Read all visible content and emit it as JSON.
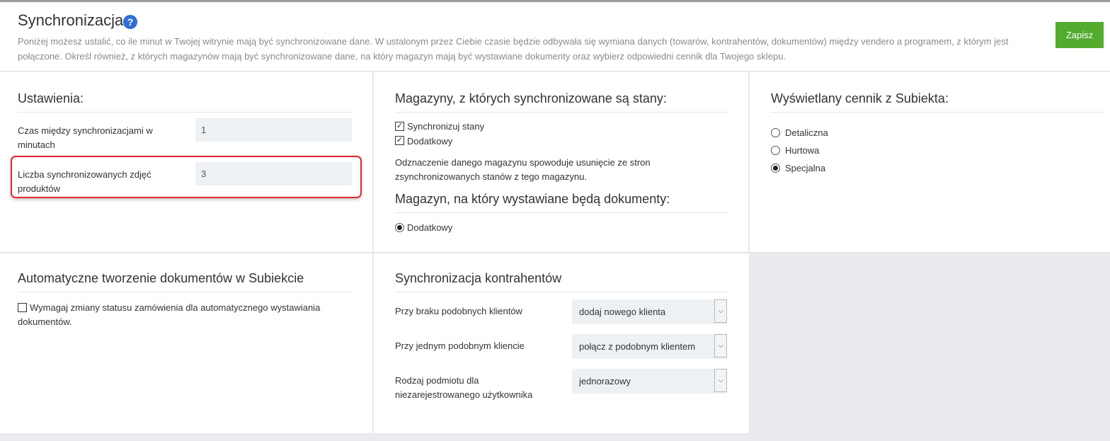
{
  "header": {
    "title": "Synchronizacja",
    "help_icon": "?",
    "description": "Poniżej możesz ustalić, co ile minut w Twojej witrynie mają być synchronizowane dane. W ustalonym przez Ciebie czasie będzie odbywała się wymiana danych (towarów, kontrahentów, dokumentów) między vendero a programem, z którym jest połączone. Określ również, z których magazynów mają być synchronizowane dane, na który magazyn mają być wystawiane dokumenty oraz wybierz odpowiedni cennik dla Twojego sklepu.",
    "save_label": "Zapisz"
  },
  "settings": {
    "title": "Ustawienia:",
    "sync_interval_label": "Czas między synchronizacjami w minutach",
    "sync_interval_value": "1",
    "photo_count_label": "Liczba synchronizowanych zdjęć produktów",
    "photo_count_value": "3"
  },
  "warehouses": {
    "title": "Magazyny, z których synchronizowane są stany:",
    "sync_stock_label": "Synchronizuj stany",
    "sync_stock_checked": true,
    "additional_label": "Dodatkowy",
    "additional_checked": true,
    "note": "Odznaczenie danego magazynu spowoduje usunięcie ze stron zsynchronizowanych stanów z tego magazynu.",
    "doc_title": "Magazyn, na który wystawiane będą dokumenty:",
    "doc_option": "Dodatkowy"
  },
  "pricelist": {
    "title": "Wyświetlany cennik z Subiekta:",
    "options": [
      "Detaliczna",
      "Hurtowa",
      "Specjalna"
    ],
    "selected": "Specjalna"
  },
  "autodocs": {
    "title": "Automatyczne tworzenie dokumentów w Subiekcie",
    "require_status_label": "Wymagaj zmiany statusu zamówienia dla automatycznego wystawiania dokumentów.",
    "require_status_checked": false
  },
  "contractors": {
    "title": "Synchronizacja kontrahentów",
    "rows": [
      {
        "label": "Przy braku podobnych klientów",
        "value": "dodaj nowego klienta"
      },
      {
        "label": "Przy jednym podobnym kliencie",
        "value": "połącz z podobnym klientem"
      },
      {
        "label": "Rodzaj podmiotu dla niezarejestrowanego użytkownika",
        "value": "jednorazowy"
      }
    ]
  },
  "colors": {
    "save_button": "#54ac2f",
    "highlight_border": "#e5262d",
    "help_icon": "#2d6fd1",
    "input_bg": "#eef1f4"
  }
}
